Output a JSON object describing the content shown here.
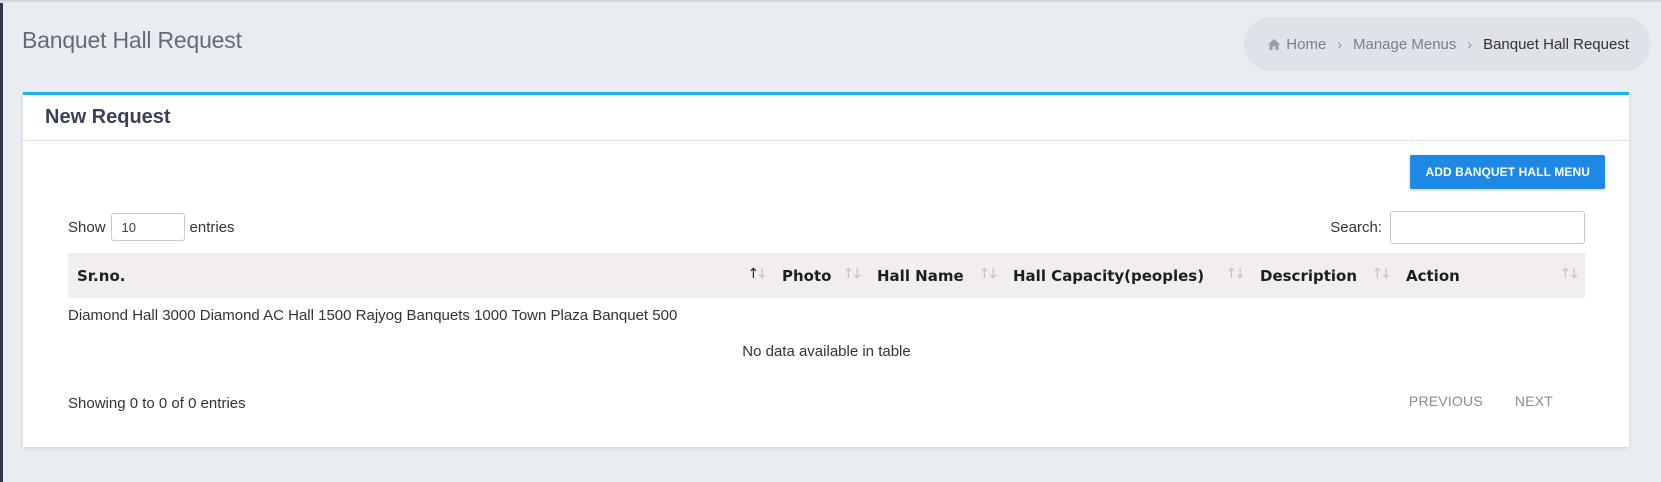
{
  "page": {
    "title": "Banquet Hall Request"
  },
  "breadcrumb": {
    "home": "Home",
    "manage": "Manage Menus",
    "current": "Banquet Hall Request",
    "home_icon": "home-icon",
    "separator_icon": "chevron-right-icon"
  },
  "card": {
    "title": "New Request",
    "add_button": "ADD BANQUET HALL MENU",
    "accent_color": "#1cb3e8",
    "button_color": "#1e88e5"
  },
  "table_controls": {
    "show_label": "Show",
    "length_value": "10",
    "entries_label": "entries",
    "search_label": "Search:",
    "search_value": ""
  },
  "table": {
    "columns": [
      "Sr.no.",
      "Photo",
      "Hall Name",
      "Hall Capacity(peoples)",
      "Description",
      "Action"
    ],
    "stray_text": "Diamond Hall 3000 Diamond AC Hall 1500 Rajyog Banquets 1000 Town Plaza Banquet 500",
    "empty_message": "No data available in table",
    "info": "Showing 0 to 0 of 0 entries"
  },
  "pagination": {
    "previous": "PREVIOUS",
    "next": "NEXT"
  }
}
